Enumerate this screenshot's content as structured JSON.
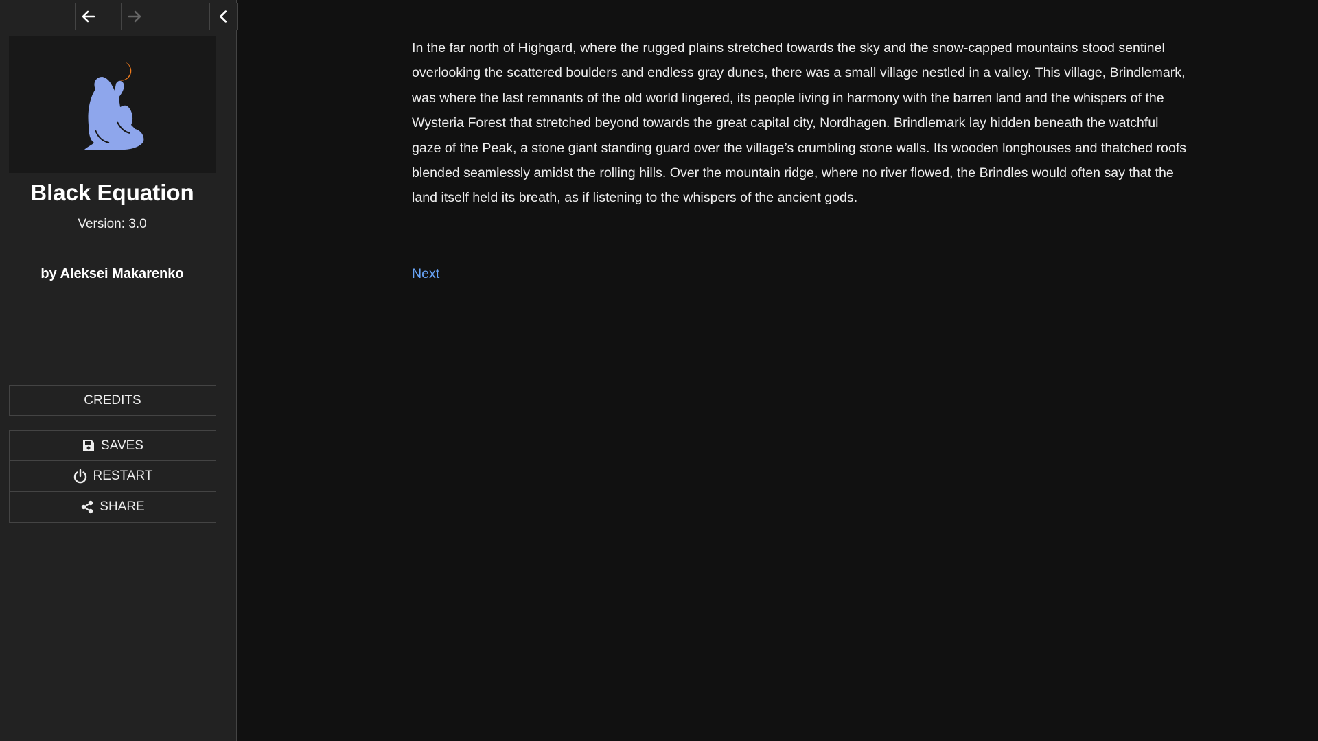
{
  "sidebar": {
    "nav": {
      "back_icon": "arrow-left-icon",
      "forward_icon": "arrow-right-icon",
      "toggle_icon": "chevron-left-icon"
    },
    "cover_icon": "seated-figure-with-moon-icon",
    "title": "Black Equation",
    "version": "Version: 3.0",
    "author": "by Aleksei Makarenko",
    "menu": {
      "credits": "CREDITS",
      "saves": "SAVES",
      "restart": "RESTART",
      "share": "SHARE"
    }
  },
  "passage": {
    "text": "In the far north of Highgard, where the rugged plains stretched towards the sky and the snow-capped mountains stood sentinel overlooking the scattered boulders and endless gray dunes, there was a small village nestled in a valley. This village, Brindlemark, was where the last remnants of the old world lingered, its people living in harmony with the barren land and the whispers of the Wysteria Forest that stretched beyond towards the great capital city, Nordhagen. Brindlemark lay hidden beneath the watchful gaze of the Peak, a stone giant standing guard over the village’s crumbling stone walls. Its wooden longhouses and thatched roofs blended seamlessly amidst the rolling hills. Over the mountain ridge, where no river flowed, the Brindles would often say that the land itself held its breath, as if listening to the whispers of the ancient gods.",
    "next_link": "Next"
  },
  "colors": {
    "background": "#111111",
    "sidebar": "#222222",
    "link": "#68a4f8",
    "cover_figure": "#8ea6ec",
    "cover_moon": "#f07b1c"
  }
}
